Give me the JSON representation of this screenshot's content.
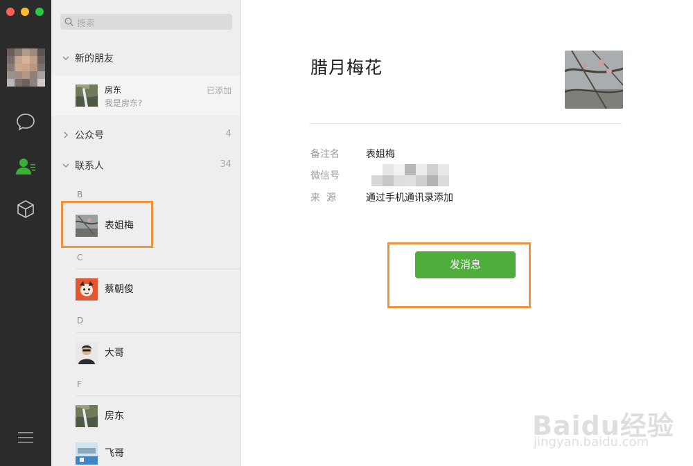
{
  "search": {
    "placeholder": "搜索"
  },
  "groups": {
    "new_friends": {
      "label": "新的朋友"
    },
    "official": {
      "label": "公众号",
      "count": "4"
    },
    "contacts": {
      "label": "联系人",
      "count": "34"
    }
  },
  "new_friend": {
    "name": "房东",
    "message": "我是房东?",
    "status": "已添加"
  },
  "sections": [
    {
      "letter": "B",
      "contacts": [
        "表姐梅"
      ]
    },
    {
      "letter": "C",
      "contacts": [
        "蔡朝俊"
      ]
    },
    {
      "letter": "D",
      "contacts": [
        "大哥"
      ]
    },
    {
      "letter": "F",
      "contacts": [
        "房东",
        "飞哥"
      ]
    }
  ],
  "profile": {
    "nickname": "腊月梅花",
    "remark_label": "备注名",
    "remark_value": "表姐梅",
    "wechat_id_label": "微信号",
    "source_label": "来  源",
    "source_value": "通过手机通讯录添加",
    "send_button_label": "发消息"
  },
  "watermark": {
    "logo": "Baidu经验",
    "url": "jingyan.baidu.com"
  },
  "colors": {
    "accent_green": "#4fae3b",
    "rail": "#2b2b2c",
    "callout": "#f0923a"
  }
}
